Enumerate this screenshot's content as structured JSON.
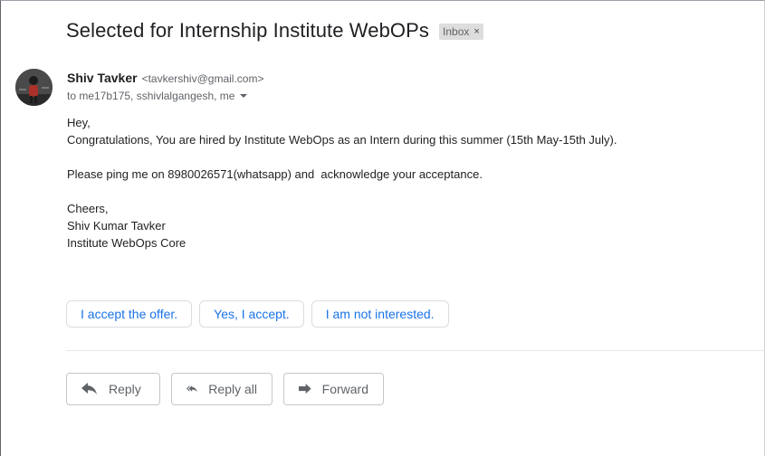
{
  "subject": "Selected for Internship Institute WebOPs",
  "label": {
    "text": "Inbox",
    "remove_glyph": "×"
  },
  "sender": {
    "name": "Shiv Tavker",
    "email": "<tavkershiv@gmail.com>",
    "to": "to me17b175, sshivlalgangesh, me",
    "avatar_icon": "user-avatar"
  },
  "body": {
    "greeting": "Hey,",
    "line1": "Congratulations, You are hired by Institute WebOps as an Intern during this summer (15th May-15th July).",
    "line2": "Please ping me on 8980026571(whatsapp) and  acknowledge your acceptance.",
    "signoff": "Cheers,",
    "signature_name": "Shiv Kumar Tavker",
    "signature_org": "Institute WebOps Core"
  },
  "smart_replies": [
    {
      "label": "I accept the offer."
    },
    {
      "label": "Yes, I accept."
    },
    {
      "label": "I am not interested."
    }
  ],
  "actions": {
    "reply": {
      "label": "Reply",
      "icon": "reply-icon"
    },
    "reply_all": {
      "label": "Reply all",
      "icon": "reply-all-icon"
    },
    "forward": {
      "label": "Forward",
      "icon": "forward-icon"
    }
  },
  "colors": {
    "link_blue": "#1a73e8",
    "text": "#202124",
    "muted": "#5f6368",
    "chip_bg": "#dddddd"
  }
}
